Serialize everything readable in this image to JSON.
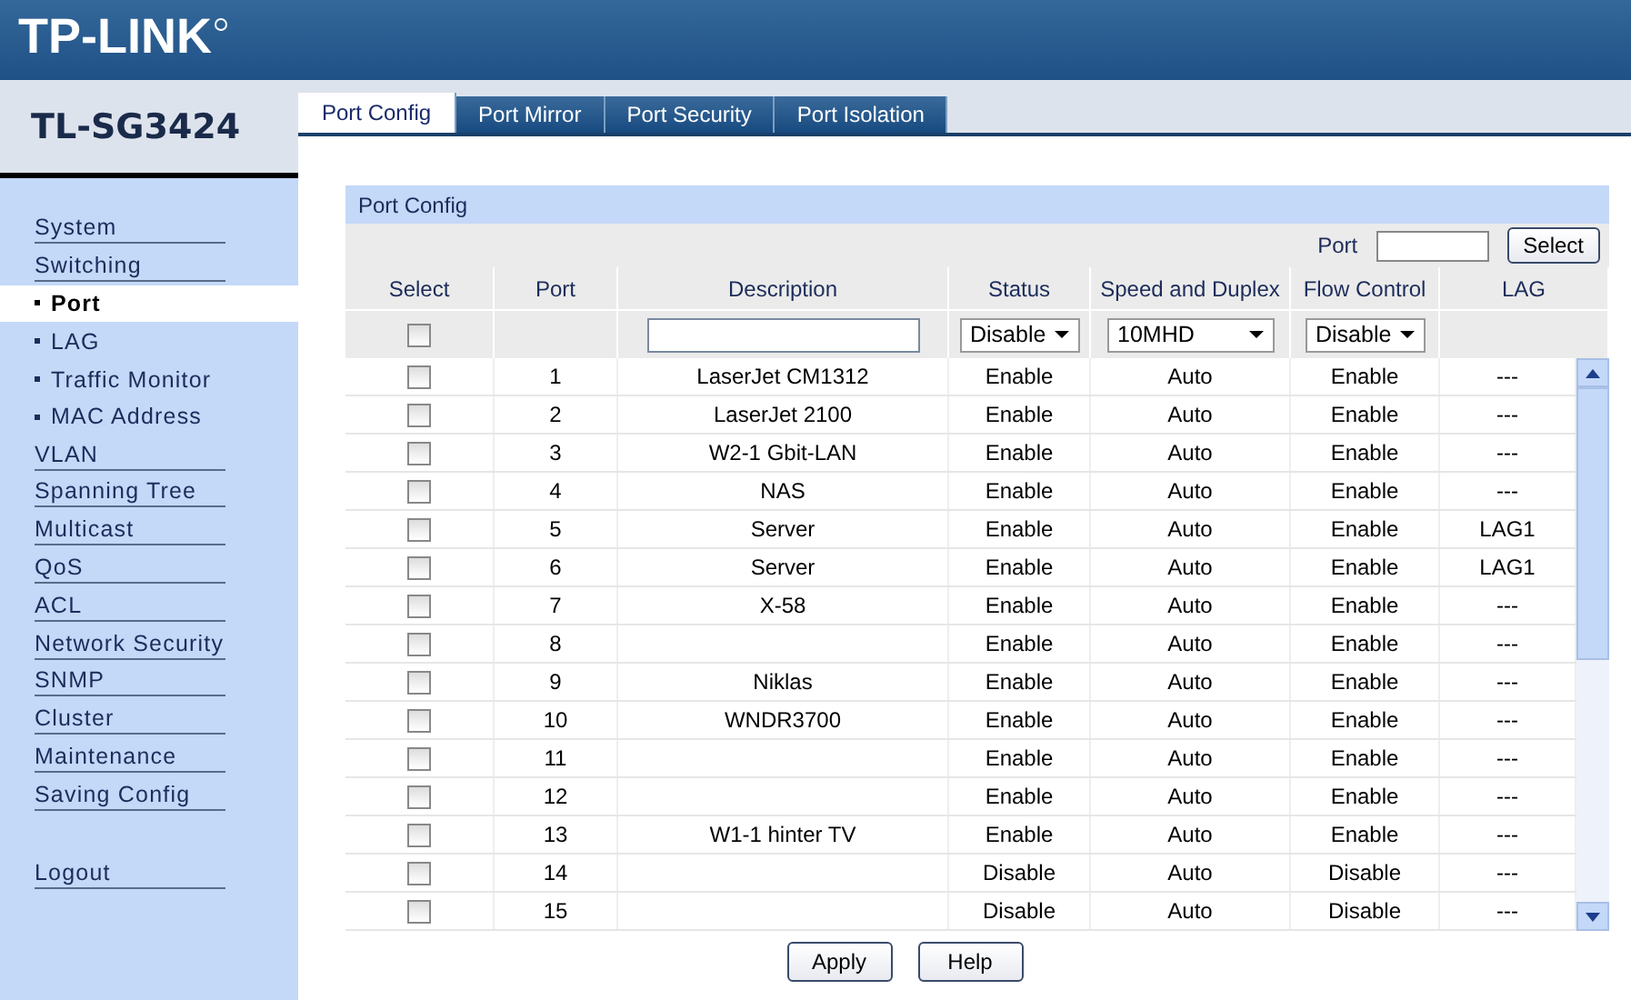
{
  "header": {
    "logo": "TP-LINK",
    "model": "TL-SG3424"
  },
  "sidebar": {
    "items": [
      {
        "label": "System",
        "kind": "group",
        "selected": false
      },
      {
        "label": "Switching",
        "kind": "group",
        "selected": false
      },
      {
        "label": "Port",
        "kind": "sub",
        "selected": true
      },
      {
        "label": "LAG",
        "kind": "sub",
        "selected": false
      },
      {
        "label": "Traffic Monitor",
        "kind": "sub",
        "selected": false
      },
      {
        "label": "MAC Address",
        "kind": "sub",
        "selected": false
      },
      {
        "label": "VLAN",
        "kind": "group",
        "selected": false
      },
      {
        "label": "Spanning Tree",
        "kind": "group",
        "selected": false
      },
      {
        "label": "Multicast",
        "kind": "group",
        "selected": false
      },
      {
        "label": "QoS",
        "kind": "group",
        "selected": false
      },
      {
        "label": "ACL",
        "kind": "group",
        "selected": false
      },
      {
        "label": "Network Security",
        "kind": "group",
        "selected": false
      },
      {
        "label": "SNMP",
        "kind": "group",
        "selected": false
      },
      {
        "label": "Cluster",
        "kind": "group",
        "selected": false
      },
      {
        "label": "Maintenance",
        "kind": "group",
        "selected": false
      },
      {
        "label": "Saving Config",
        "kind": "group",
        "selected": false
      }
    ],
    "logout": "Logout"
  },
  "tabs": [
    {
      "label": "Port Config",
      "selected": true
    },
    {
      "label": "Port Mirror",
      "selected": false
    },
    {
      "label": "Port Security",
      "selected": false
    },
    {
      "label": "Port Isolation",
      "selected": false
    }
  ],
  "panel": {
    "title": "Port Config",
    "port_search": {
      "label": "Port",
      "button": "Select"
    }
  },
  "table": {
    "columns": [
      "Select",
      "Port",
      "Description",
      "Status",
      "Speed and Duplex",
      "Flow Control",
      "LAG"
    ],
    "filter": {
      "checked": false,
      "status": "Disable",
      "speed": "10MHD",
      "flow_control": "Disable"
    },
    "rows": [
      {
        "checked": false,
        "port": "1",
        "description": "LaserJet CM1312",
        "status": "Enable",
        "speed": "Auto",
        "flow_control": "Enable",
        "lag": "---"
      },
      {
        "checked": false,
        "port": "2",
        "description": "LaserJet 2100",
        "status": "Enable",
        "speed": "Auto",
        "flow_control": "Enable",
        "lag": "---"
      },
      {
        "checked": false,
        "port": "3",
        "description": "W2-1 Gbit-LAN",
        "status": "Enable",
        "speed": "Auto",
        "flow_control": "Enable",
        "lag": "---"
      },
      {
        "checked": false,
        "port": "4",
        "description": "NAS",
        "status": "Enable",
        "speed": "Auto",
        "flow_control": "Enable",
        "lag": "---"
      },
      {
        "checked": false,
        "port": "5",
        "description": "Server",
        "status": "Enable",
        "speed": "Auto",
        "flow_control": "Enable",
        "lag": "LAG1"
      },
      {
        "checked": false,
        "port": "6",
        "description": "Server",
        "status": "Enable",
        "speed": "Auto",
        "flow_control": "Enable",
        "lag": "LAG1"
      },
      {
        "checked": false,
        "port": "7",
        "description": "X-58",
        "status": "Enable",
        "speed": "Auto",
        "flow_control": "Enable",
        "lag": "---"
      },
      {
        "checked": false,
        "port": "8",
        "description": "",
        "status": "Enable",
        "speed": "Auto",
        "flow_control": "Enable",
        "lag": "---"
      },
      {
        "checked": false,
        "port": "9",
        "description": "Niklas",
        "status": "Enable",
        "speed": "Auto",
        "flow_control": "Enable",
        "lag": "---"
      },
      {
        "checked": false,
        "port": "10",
        "description": "WNDR3700",
        "status": "Enable",
        "speed": "Auto",
        "flow_control": "Enable",
        "lag": "---"
      },
      {
        "checked": false,
        "port": "11",
        "description": "",
        "status": "Enable",
        "speed": "Auto",
        "flow_control": "Enable",
        "lag": "---"
      },
      {
        "checked": false,
        "port": "12",
        "description": "",
        "status": "Enable",
        "speed": "Auto",
        "flow_control": "Enable",
        "lag": "---"
      },
      {
        "checked": false,
        "port": "13",
        "description": "W1-1 hinter TV",
        "status": "Enable",
        "speed": "Auto",
        "flow_control": "Enable",
        "lag": "---"
      },
      {
        "checked": false,
        "port": "14",
        "description": "",
        "status": "Disable",
        "speed": "Auto",
        "flow_control": "Disable",
        "lag": "---"
      },
      {
        "checked": false,
        "port": "15",
        "description": "",
        "status": "Disable",
        "speed": "Auto",
        "flow_control": "Disable",
        "lag": "---"
      }
    ]
  },
  "buttons": [
    "Apply",
    "Help"
  ]
}
